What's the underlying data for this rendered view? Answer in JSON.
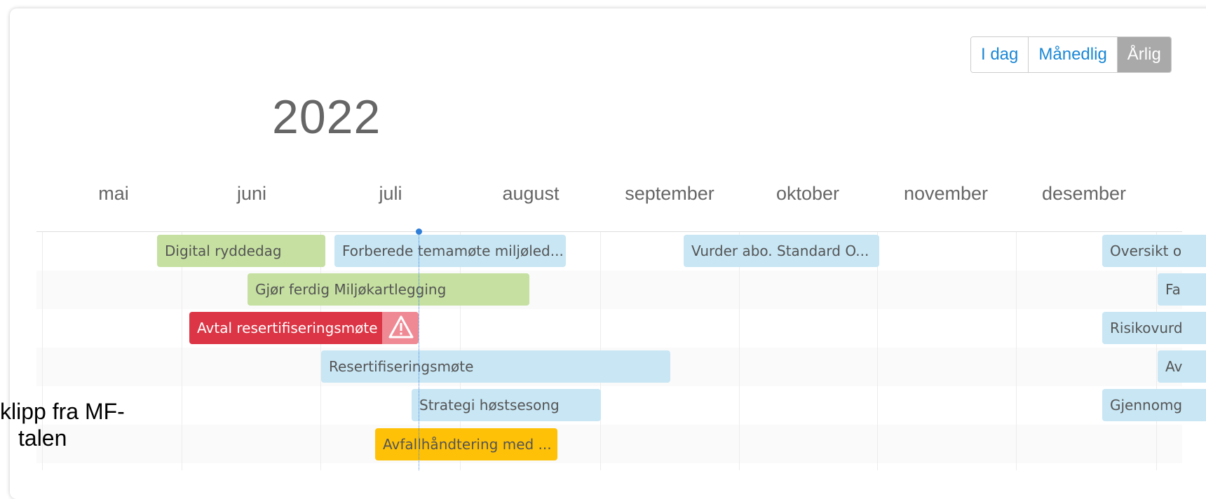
{
  "view_switch": {
    "today": "I dag",
    "monthly": "Månedlig",
    "yearly": "Årlig"
  },
  "year": "2022",
  "months": [
    "mai",
    "juni",
    "juli",
    "august",
    "september",
    "oktober",
    "november",
    "desember"
  ],
  "events": [
    {
      "label": "Digital ryddedag",
      "color": "green"
    },
    {
      "label": "Forberede temamøte miljøled...",
      "color": "blue"
    },
    {
      "label": "Vurder abo. Standard O...",
      "color": "blue"
    },
    {
      "label": "Oversikt o",
      "color": "blue"
    },
    {
      "label": "Gjør ferdig Miljøkartlegging",
      "color": "green"
    },
    {
      "label": "Fa",
      "color": "blue"
    },
    {
      "label": "Avtal resertifiseringsmøte",
      "color": "red",
      "warning": true
    },
    {
      "label": "Risikovurd",
      "color": "blue"
    },
    {
      "label": "Resertifiseringsmøte",
      "color": "blue"
    },
    {
      "label": "Av",
      "color": "blue"
    },
    {
      "label": "Strategi høstsesong",
      "color": "blue"
    },
    {
      "label": "Gjennomg",
      "color": "blue"
    },
    {
      "label": "Avfallhåndtering med ...",
      "color": "orange"
    }
  ],
  "caption": {
    "line1": "klipp fra MF-",
    "line2": "talen"
  },
  "colors": {
    "green": "#c5e0a0",
    "blue": "#c8e6f4",
    "red": "#dc3545",
    "orange": "#ffc107",
    "warning_bg": "#ef8a95",
    "active_button": "#a9a9a9",
    "link_blue": "#1a88d6",
    "today_marker": "#2f7fd9"
  },
  "icons": {
    "warning": "warning-triangle-icon"
  }
}
